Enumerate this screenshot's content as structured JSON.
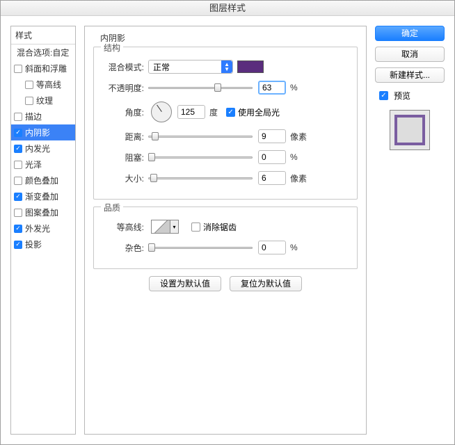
{
  "title": "图层样式",
  "sidebar": {
    "header": "样式",
    "blend_header": "混合选项:自定",
    "items": [
      {
        "label": "斜面和浮雕",
        "checked": false,
        "indent": false
      },
      {
        "label": "等高线",
        "checked": false,
        "indent": true
      },
      {
        "label": "纹理",
        "checked": false,
        "indent": true
      },
      {
        "label": "描边",
        "checked": false,
        "indent": false
      },
      {
        "label": "内阴影",
        "checked": true,
        "indent": false,
        "selected": true
      },
      {
        "label": "内发光",
        "checked": true,
        "indent": false
      },
      {
        "label": "光泽",
        "checked": false,
        "indent": false
      },
      {
        "label": "颜色叠加",
        "checked": false,
        "indent": false
      },
      {
        "label": "渐变叠加",
        "checked": true,
        "indent": false
      },
      {
        "label": "图案叠加",
        "checked": false,
        "indent": false
      },
      {
        "label": "外发光",
        "checked": true,
        "indent": false
      },
      {
        "label": "投影",
        "checked": true,
        "indent": false
      }
    ]
  },
  "panel": {
    "title": "内阴影",
    "group_struct": "结构",
    "blend_mode_label": "混合模式:",
    "blend_mode_value": "正常",
    "color": "#5a2d7d",
    "opacity_label": "不透明度:",
    "opacity_value": "63",
    "opacity_unit": "%",
    "angle_label": "角度:",
    "angle_value": "125",
    "angle_unit": "度",
    "global_light_label": "使用全局光",
    "global_light_checked": true,
    "distance_label": "距离:",
    "distance_value": "9",
    "distance_unit": "像素",
    "spread_label": "阻塞:",
    "spread_value": "0",
    "spread_unit": "%",
    "size_label": "大小:",
    "size_value": "6",
    "size_unit": "像素",
    "group_quality": "品质",
    "contour_label": "等高线:",
    "antialias_label": "消除锯齿",
    "antialias_checked": false,
    "noise_label": "杂色:",
    "noise_value": "0",
    "noise_unit": "%",
    "default_btn": "设置为默认值",
    "reset_btn": "复位为默认值"
  },
  "right": {
    "ok": "确定",
    "cancel": "取消",
    "new_style": "新建样式...",
    "preview_checked": true,
    "preview_label": "预览"
  }
}
